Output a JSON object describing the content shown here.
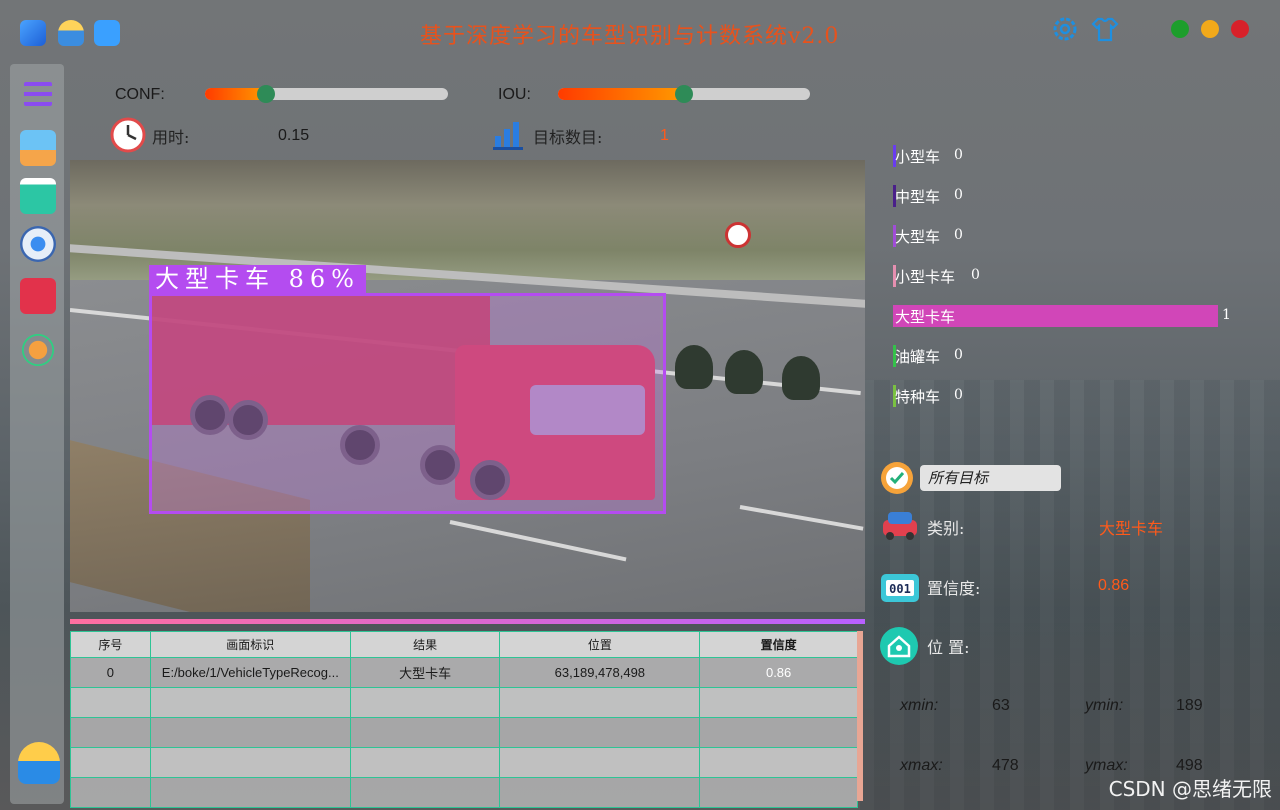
{
  "app": {
    "title": "基于深度学习的车型识别与计数系统v2.0"
  },
  "sliders": {
    "conf": {
      "label": "CONF:",
      "value": 0.25
    },
    "iou": {
      "label": "IOU:",
      "value": 0.5
    }
  },
  "stats": {
    "time_label": "用时:",
    "time_value": "0.15",
    "count_label": "目标数目:",
    "count_value": "1"
  },
  "detection": {
    "label": "大型卡车 86%"
  },
  "table": {
    "headers": [
      "序号",
      "画面标识",
      "结果",
      "位置",
      "置信度"
    ],
    "rows": [
      [
        "0",
        "E:/boke/1/VehicleTypeRecog...",
        "大型卡车",
        "63,189,478,498",
        "0.86"
      ]
    ]
  },
  "counts": [
    {
      "name": "小型车",
      "value": "0",
      "color": "#6a3cf0"
    },
    {
      "name": "中型车",
      "value": "0",
      "color": "#4a1f8a"
    },
    {
      "name": "大型车",
      "value": "0",
      "color": "#a14cd8"
    },
    {
      "name": "小型卡车",
      "value": "0",
      "color": "#e58fb0"
    },
    {
      "name": "大型卡车",
      "value": "1",
      "color": "#d146b8"
    },
    {
      "name": "油罐车",
      "value": "0",
      "color": "#34c24a"
    },
    {
      "name": "特种车",
      "value": "0",
      "color": "#7ac242"
    }
  ],
  "details": {
    "target_select": "所有目标",
    "class_label": "类别:",
    "class_value": "大型卡车",
    "conf_label": "置信度:",
    "conf_value": "0.86",
    "pos_label": "位 置:",
    "xmin_label": "xmin:",
    "xmin": "63",
    "ymin_label": "ymin:",
    "ymin": "189",
    "xmax_label": "xmax:",
    "xmax": "478",
    "ymax_label": "ymax:",
    "ymax": "498"
  },
  "watermark": "CSDN @思绪无限"
}
